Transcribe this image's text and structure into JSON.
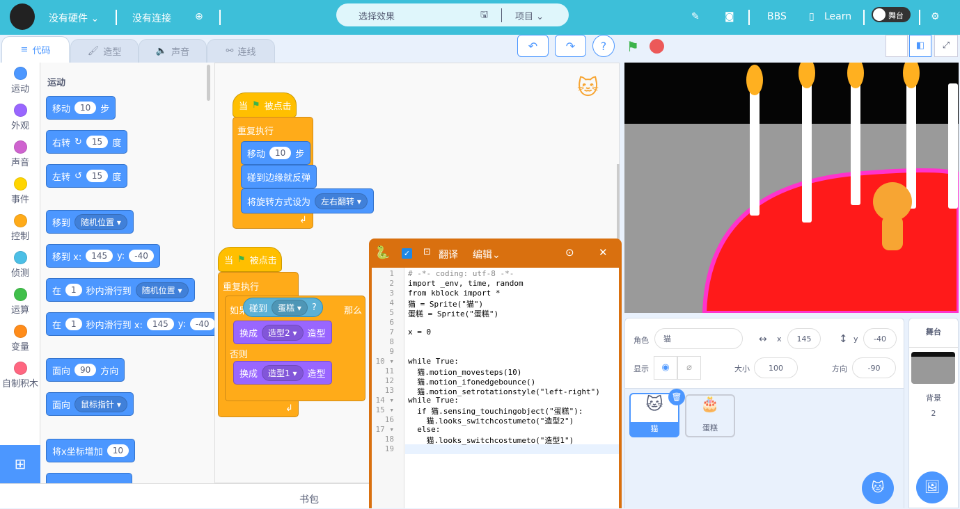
{
  "topbar": {
    "hardware": "没有硬件",
    "connection": "没有连接",
    "effect": "选择效果",
    "project": "项目",
    "bbs": "BBS",
    "learn": "Learn",
    "stage_toggle": "舞台"
  },
  "tabs": [
    {
      "label": "代码"
    },
    {
      "label": "造型"
    },
    {
      "label": "声音"
    },
    {
      "label": "连线"
    }
  ],
  "toolbar": {
    "undo": "↶",
    "redo": "↷",
    "help": "?"
  },
  "categories": [
    {
      "label": "运动",
      "color": "#4c97ff"
    },
    {
      "label": "外观",
      "color": "#9966ff"
    },
    {
      "label": "声音",
      "color": "#cf63cf"
    },
    {
      "label": "事件",
      "color": "#ffd500"
    },
    {
      "label": "控制",
      "color": "#ffab19"
    },
    {
      "label": "侦测",
      "color": "#4cbfe6"
    },
    {
      "label": "运算",
      "color": "#40bf4a"
    },
    {
      "label": "变量",
      "color": "#ff8c1a"
    },
    {
      "label": "自制积木",
      "color": "#ff6680"
    }
  ],
  "palette": {
    "heading": "运动",
    "move": {
      "a": "移动",
      "v": "10",
      "b": "步"
    },
    "turn_right": {
      "a": "右转",
      "v": "15",
      "b": "度"
    },
    "turn_left": {
      "a": "左转",
      "v": "15",
      "b": "度"
    },
    "goto": {
      "a": "移到",
      "dd": "随机位置"
    },
    "gotoxy": {
      "a": "移到 x:",
      "x": "145",
      "b": "y:",
      "y": "-40"
    },
    "glide": {
      "a": "在",
      "v": "1",
      "b": "秒内滑行到",
      "dd": "随机位置"
    },
    "glidexy": {
      "a": "在",
      "v": "1",
      "b": "秒内滑行到 x:",
      "x": "145",
      "c": "y:",
      "y": "-40"
    },
    "point": {
      "a": "面向",
      "v": "90",
      "b": "方向"
    },
    "pointto": {
      "a": "面向",
      "dd": "鼠标指针"
    },
    "changex": {
      "a": "将x坐标增加",
      "v": "10"
    }
  },
  "script1": {
    "hat": "当",
    "hat2": "被点击",
    "forever": "重复执行",
    "move": "移动",
    "move_v": "10",
    "move_b": "步",
    "bounce": "碰到边缘就反弹",
    "rot": "将旋转方式设为",
    "rot_dd": "左右翻转"
  },
  "script2": {
    "hat": "当",
    "hat2": "被点击",
    "forever": "重复执行",
    "if": "如果",
    "touch": "碰到",
    "touch_dd": "蛋糕",
    "q": "?",
    "then": "那么",
    "sw": "换成",
    "sw_dd1": "造型2",
    "sw_b": "造型",
    "else": "否则",
    "sw_dd2": "造型1"
  },
  "bag": "书包",
  "code": {
    "translate": "翻译",
    "edit": "编辑",
    "lines": [
      "# -*- coding: utf-8 -*-",
      "import _env, time, random",
      "from kblock import *",
      "猫 = Sprite(\"猫\")",
      "蛋糕 = Sprite(\"蛋糕\")",
      "",
      "x = 0",
      "",
      "",
      "while True:",
      "  猫.motion_movesteps(10)",
      "  猫.motion_ifonedgebounce()",
      "  猫.motion_setrotationstyle(\"left-right\")",
      "while True:",
      "  if 猫.sensing_touchingobject(\"蛋糕\"):",
      "    猫.looks_switchcostumeto(\"造型2\")",
      "  else:",
      "    猫.looks_switchcostumeto(\"造型1\")",
      ""
    ]
  },
  "sprite_info": {
    "sprite_label": "角色",
    "sprite_name": "猫",
    "x_label": "x",
    "x": "145",
    "y_label": "y",
    "y": "-40",
    "show_label": "显示",
    "size_label": "大小",
    "size": "100",
    "dir_label": "方向",
    "dir": "-90"
  },
  "sprites": [
    {
      "name": "猫",
      "selected": true
    },
    {
      "name": "蛋糕",
      "selected": false
    }
  ],
  "stage_pane": {
    "title": "舞台",
    "backdrop_label": "背景",
    "backdrop_count": "2"
  }
}
